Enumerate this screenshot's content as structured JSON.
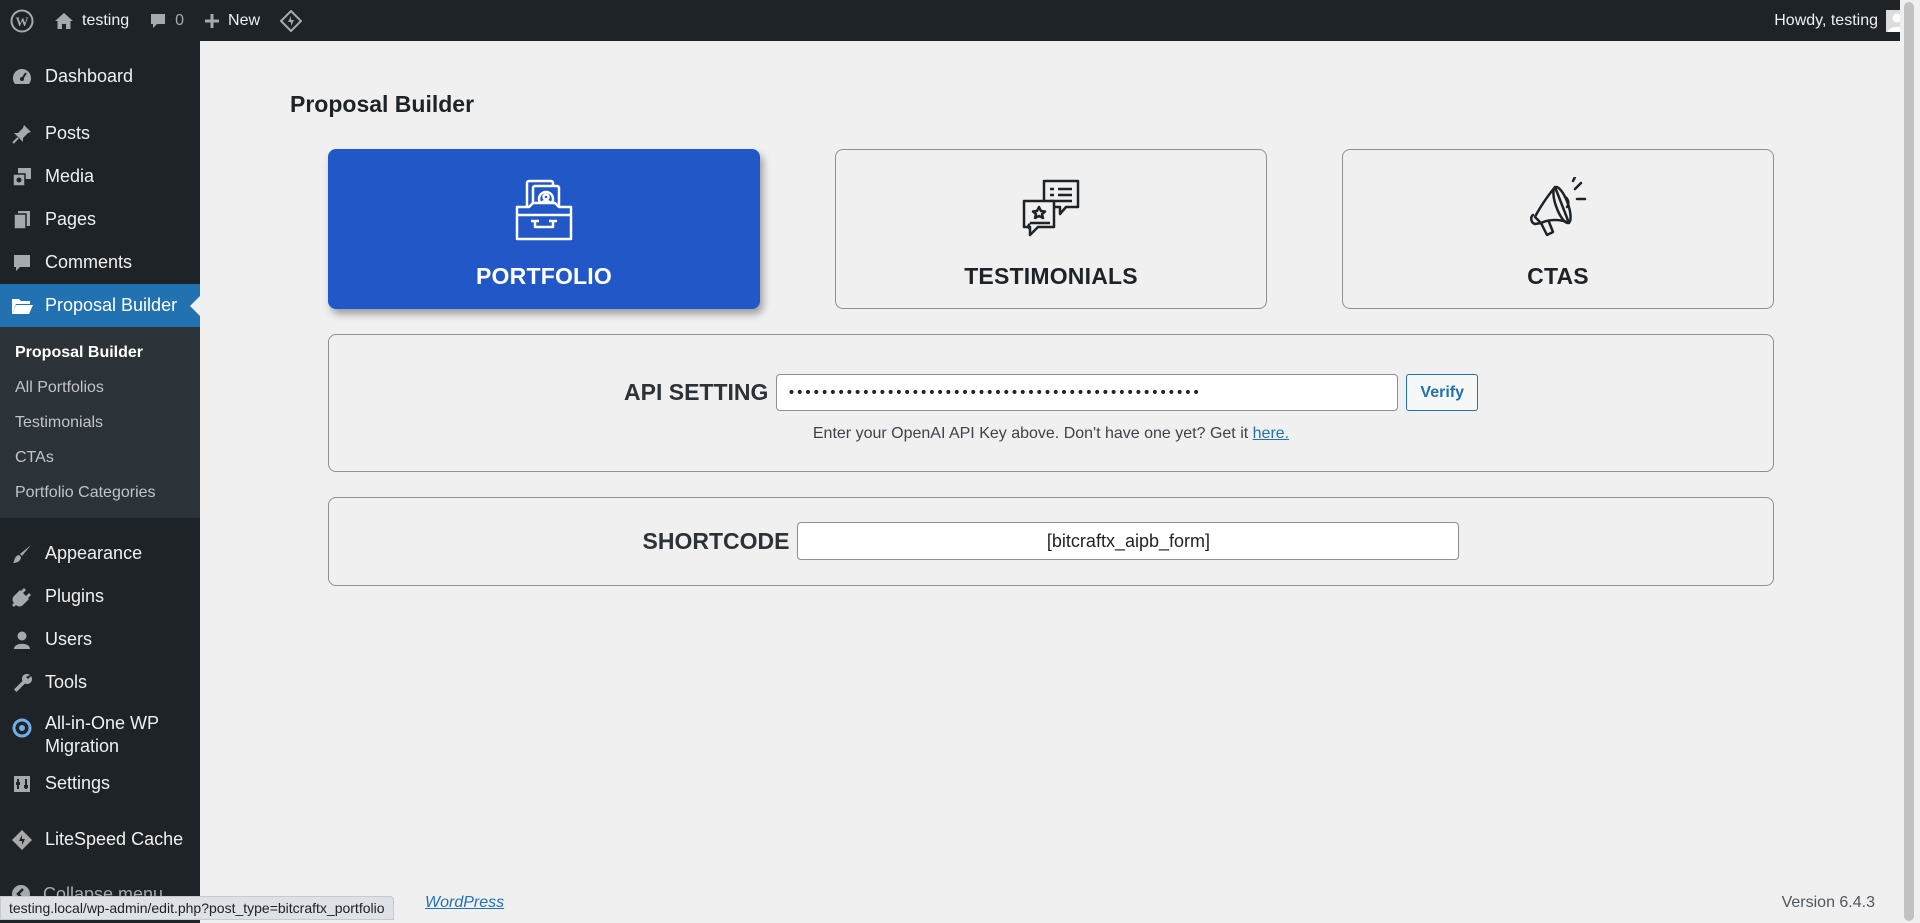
{
  "admin_bar": {
    "site_name": "testing",
    "comments_count": "0",
    "new_label": "New",
    "greeting": "Howdy, testing"
  },
  "sidebar": {
    "items": [
      {
        "label": "Dashboard",
        "icon": "dashboard-icon"
      },
      {
        "label": "Posts",
        "icon": "pin-icon"
      },
      {
        "label": "Media",
        "icon": "media-icon"
      },
      {
        "label": "Pages",
        "icon": "pages-icon"
      },
      {
        "label": "Comments",
        "icon": "comment-icon"
      },
      {
        "label": "Proposal Builder",
        "icon": "folder-open-icon"
      },
      {
        "label": "Appearance",
        "icon": "brush-icon"
      },
      {
        "label": "Plugins",
        "icon": "plug-icon"
      },
      {
        "label": "Users",
        "icon": "user-icon"
      },
      {
        "label": "Tools",
        "icon": "wrench-icon"
      },
      {
        "label": "All-in-One WP Migration",
        "icon": "migration-icon"
      },
      {
        "label": "Settings",
        "icon": "settings-icon"
      },
      {
        "label": "LiteSpeed Cache",
        "icon": "litespeed-icon"
      }
    ],
    "submenu": [
      {
        "label": "Proposal Builder"
      },
      {
        "label": "All Portfolios"
      },
      {
        "label": "Testimonials"
      },
      {
        "label": "CTAs"
      },
      {
        "label": "Portfolio Categories"
      }
    ],
    "collapse_label": "Collapse menu"
  },
  "main": {
    "title": "Proposal Builder",
    "cards": [
      {
        "label": "PORTFOLIO",
        "icon": "portfolio-folder-icon"
      },
      {
        "label": "TESTIMONIALS",
        "icon": "chat-bubbles-icon"
      },
      {
        "label": "CTAS",
        "icon": "megaphone-icon"
      }
    ],
    "api": {
      "label": "API SETTING",
      "value": "••••••••••••••••••••••••••••••••••••••••••••••••••",
      "verify_label": "Verify",
      "help_text": "Enter your OpenAI API Key above. Don't have one yet? Get it",
      "help_link": "here."
    },
    "shortcode": {
      "label": "SHORTCODE",
      "value": "[bitcraftx_aipb_form]"
    }
  },
  "footer": {
    "credit_link": "WordPress",
    "version": "Version 6.4.3"
  },
  "statusbar": {
    "url": "testing.local/wp-admin/edit.php?post_type=bitcraftx_portfolio"
  },
  "colors": {
    "admin_dark": "#1d2327",
    "accent": "#2271b1",
    "active_card": "#2157c7",
    "background": "#f0f0f1"
  }
}
